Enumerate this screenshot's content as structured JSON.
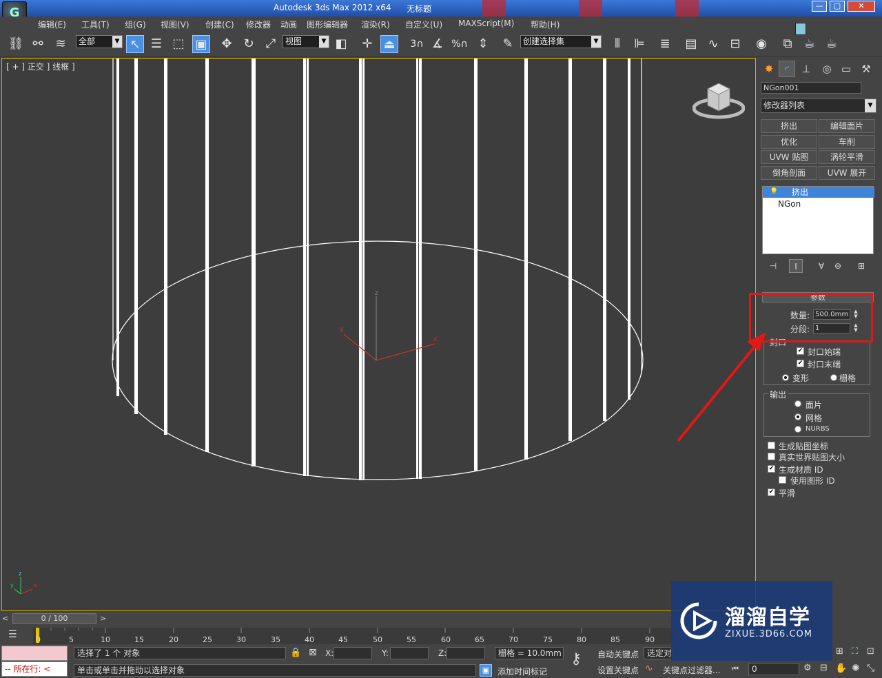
{
  "title": {
    "app": "Autodesk 3ds Max  2012 x64",
    "document": "无标题"
  },
  "window_buttons": [
    "—",
    "▢",
    "✕"
  ],
  "menu": [
    "编辑(E)",
    "工具(T)",
    "组(G)",
    "视图(V)",
    "创建(C)",
    "修改器",
    "动画",
    "图形编辑器",
    "渲染(R)",
    "自定义(U)",
    "MAXScript(M)",
    "帮助(H)"
  ],
  "toolbar": {
    "selection_filter": "全部",
    "ref_coord": "视图",
    "named_selection": "创建选择集",
    "snap_3": "3",
    "percent_snap": "%"
  },
  "viewport": {
    "label": "[ + ] 正交 ] 线框 ]",
    "axis_labels": {
      "z": "z",
      "y": "y",
      "x": "x"
    }
  },
  "command_panel": {
    "object_name": "NGon001",
    "object_color": "#86c7d8",
    "modifier_list": "修改器列表",
    "modifier_buttons": [
      "挤出",
      "编辑面片",
      "优化",
      "车削",
      "UVW 贴图",
      "涡轮平滑",
      "倒角剖面",
      "UVW 展开"
    ],
    "stack": [
      "挤出",
      "NGon"
    ],
    "rollout_title": "参数",
    "amount_label": "数量:",
    "amount_value": "500.0mm",
    "segments_label": "分段:",
    "segments_value": "1",
    "capping_title": "封口",
    "cap_start": "封口始端",
    "cap_end": "封口末端",
    "morph": "变形",
    "grid": "栅格",
    "output_title": "输出",
    "patch": "面片",
    "mesh": "网格",
    "nurbs": "NURBS",
    "gen_map_coords": "生成贴图坐标",
    "real_world_map": "真实世界贴图大小",
    "gen_mat_ids": "生成材质 ID",
    "use_shape_ids": "使用图形 ID",
    "smooth": "平滑",
    "checked": {
      "cap_start": true,
      "cap_end": true,
      "gen_map_coords": false,
      "real_world_map": false,
      "gen_mat_ids": true,
      "use_shape_ids": false,
      "smooth": true
    },
    "radio_selected": {
      "capping": "变形",
      "output": "网格"
    }
  },
  "timeline": {
    "frame": "0 / 100",
    "prev": "<",
    "next": ">",
    "ticks": [
      "0",
      "5",
      "10",
      "15",
      "20",
      "25",
      "30",
      "35",
      "40",
      "45",
      "50",
      "55",
      "60",
      "65",
      "70",
      "75",
      "80",
      "85",
      "90"
    ]
  },
  "status": {
    "script_label": "所在行:",
    "selected_msg": "选择了 1 个 对象",
    "prompt_msg": "单击或单击并拖动以选择对象",
    "x_label": "X:",
    "y_label": "Y:",
    "z_label": "Z:",
    "grid": "栅格 = 10.0mm",
    "add_time_tag": "添加时间标记",
    "auto_key": "自动关键点",
    "set_key": "设置关键点",
    "selected_sel": "选定对",
    "key_filters": "关键点过滤器...",
    "frame_field": "0"
  },
  "watermark": {
    "main": "溜溜自学",
    "sub": "ZIXUE.3D66.COM"
  },
  "colors": {
    "highlight": "#e01818",
    "viewport_bg": "#3d3d3d",
    "active_border": "#d6b000",
    "selected": "#3f84d8"
  }
}
